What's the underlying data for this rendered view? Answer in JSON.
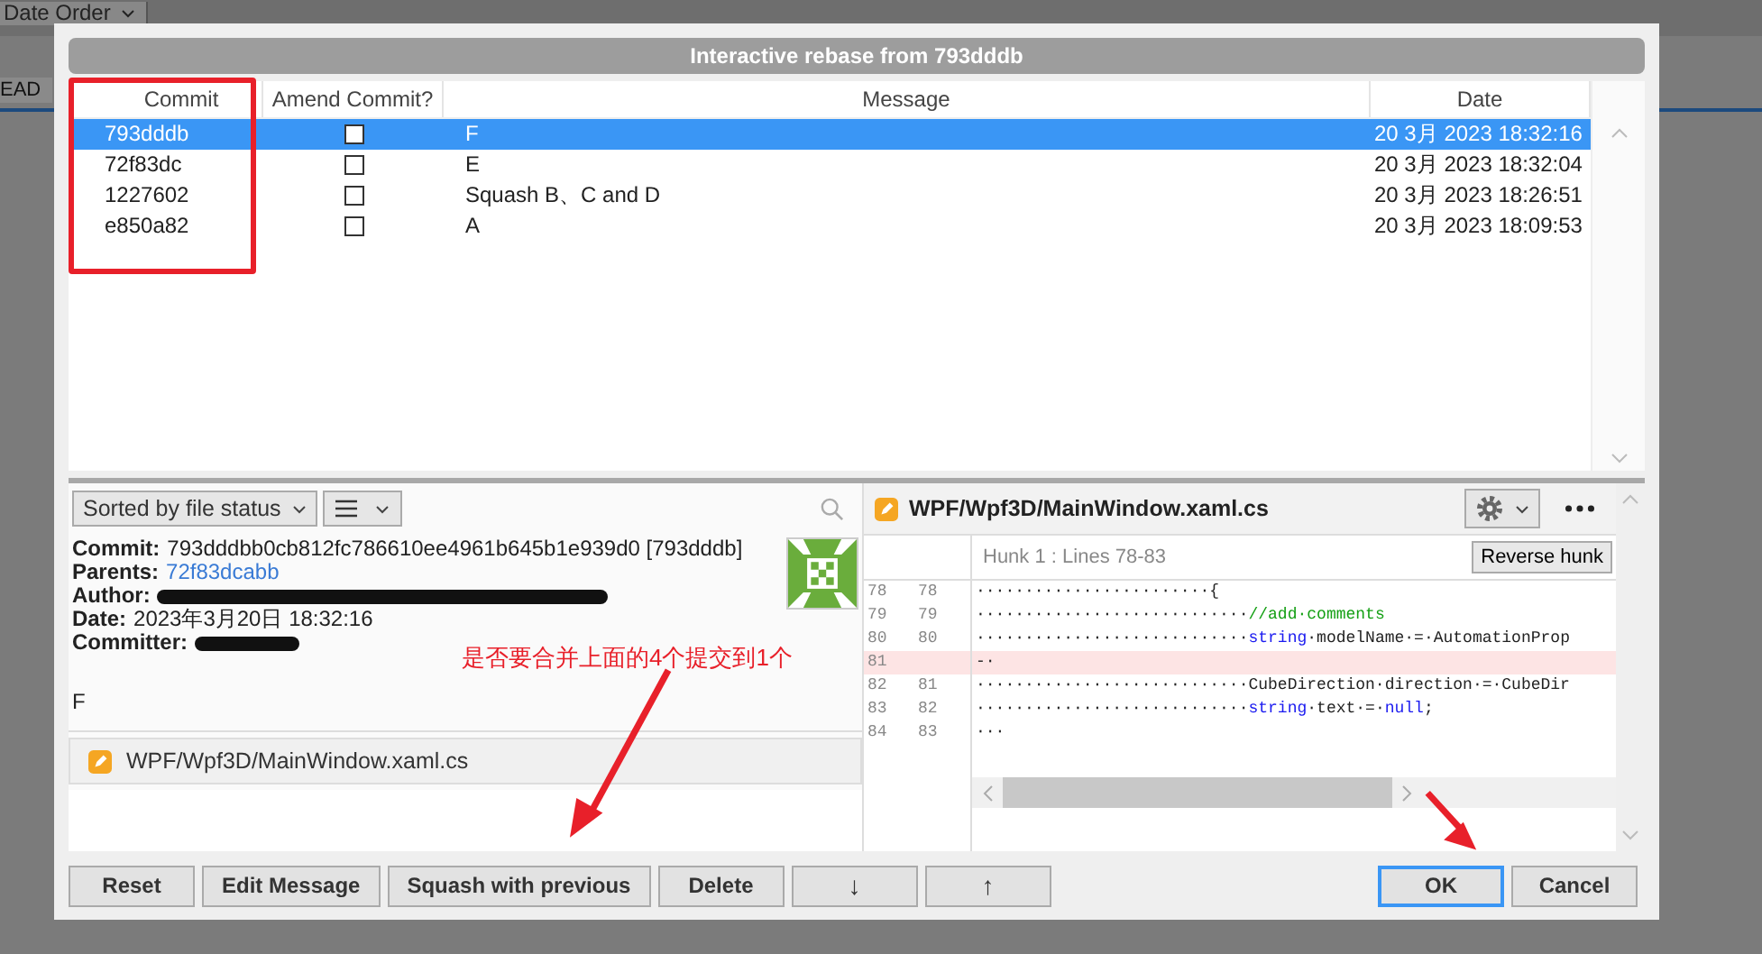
{
  "background": {
    "sort_dropdown": "Date Order",
    "branch_label": "EAD"
  },
  "dialog": {
    "title": "Interactive rebase from 793dddb"
  },
  "table": {
    "columns": [
      "Commit",
      "Amend Commit?",
      "Message",
      "Date"
    ],
    "rows": [
      {
        "commit": "793dddb",
        "amend": false,
        "message": "F",
        "date": "20 3月 2023 18:32:16",
        "selected": true
      },
      {
        "commit": "72f83dc",
        "amend": false,
        "message": "E",
        "date": "20 3月 2023 18:32:04",
        "selected": false
      },
      {
        "commit": "1227602",
        "amend": false,
        "message": "Squash B、C and D",
        "date": "20 3月 2023 18:26:51",
        "selected": false
      },
      {
        "commit": "e850a82",
        "amend": false,
        "message": "A",
        "date": "20 3月 2023 18:09:53",
        "selected": false
      }
    ]
  },
  "details": {
    "sort_select": "Sorted by file status",
    "fields": [
      {
        "label": "Commit:",
        "value": "793dddbb0cb812fc786610ee4961b645b1e939d0 [793dddb]",
        "kind": "text"
      },
      {
        "label": "Parents:",
        "value": "72f83dcabb",
        "kind": "link"
      },
      {
        "label": "Author:",
        "kind": "redacted"
      },
      {
        "label": "Date:",
        "value": "2023年3月20日 18:32:16",
        "kind": "text"
      },
      {
        "label": "Committer:",
        "kind": "redacted"
      }
    ],
    "message": "F",
    "files": [
      {
        "path": "WPF/Wpf3D/MainWindow.xaml.cs"
      }
    ]
  },
  "diff": {
    "file": "WPF/Wpf3D/MainWindow.xaml.cs",
    "hunk": "Hunk 1 : Lines 78-83",
    "reverse_button": "Reverse hunk",
    "lines": [
      {
        "old": "78",
        "new": "78",
        "kind": "context",
        "tokens": [
          {
            "kind": "plain",
            "text": "························{"
          }
        ]
      },
      {
        "old": "79",
        "new": "79",
        "kind": "context",
        "tokens": [
          {
            "kind": "plain",
            "text": "····························"
          },
          {
            "kind": "comment",
            "text": "//add·comments"
          }
        ]
      },
      {
        "old": "80",
        "new": "80",
        "kind": "context",
        "tokens": [
          {
            "kind": "plain",
            "text": "····························"
          },
          {
            "kind": "keyword",
            "text": "string"
          },
          {
            "kind": "plain",
            "text": "·modelName·=·AutomationProp"
          }
        ]
      },
      {
        "old": "81",
        "kind": "removed",
        "tokens": [
          {
            "kind": "plain",
            "text": "-·"
          }
        ]
      },
      {
        "old": "82",
        "new": "81",
        "kind": "context",
        "tokens": [
          {
            "kind": "plain",
            "text": "····························CubeDirection·direction·=·CubeDir"
          }
        ]
      },
      {
        "old": "83",
        "new": "82",
        "kind": "context",
        "tokens": [
          {
            "kind": "plain",
            "text": "····························"
          },
          {
            "kind": "keyword",
            "text": "string"
          },
          {
            "kind": "plain",
            "text": "·text·=·"
          },
          {
            "kind": "keyword",
            "text": "null"
          },
          {
            "kind": "plain",
            "text": ";"
          }
        ]
      },
      {
        "old": "84",
        "new": "83",
        "kind": "context",
        "tokens": [
          {
            "kind": "plain",
            "text": "···"
          }
        ]
      }
    ]
  },
  "buttons": [
    {
      "label": "Reset",
      "kind": "text",
      "primary": false
    },
    {
      "label": "Edit Message",
      "kind": "text",
      "primary": false
    },
    {
      "label": "Squash with previous",
      "kind": "text",
      "primary": false
    },
    {
      "label": "Delete",
      "kind": "text",
      "primary": false
    },
    {
      "label": "↓",
      "kind": "arrow",
      "primary": false
    },
    {
      "label": "↑",
      "kind": "arrow",
      "primary": false
    },
    {
      "label": "OK",
      "kind": "confirm",
      "primary": true
    },
    {
      "label": "Cancel",
      "kind": "confirm",
      "primary": false
    }
  ],
  "annotation": {
    "note": "是否要合并上面的4个提交到1个"
  }
}
